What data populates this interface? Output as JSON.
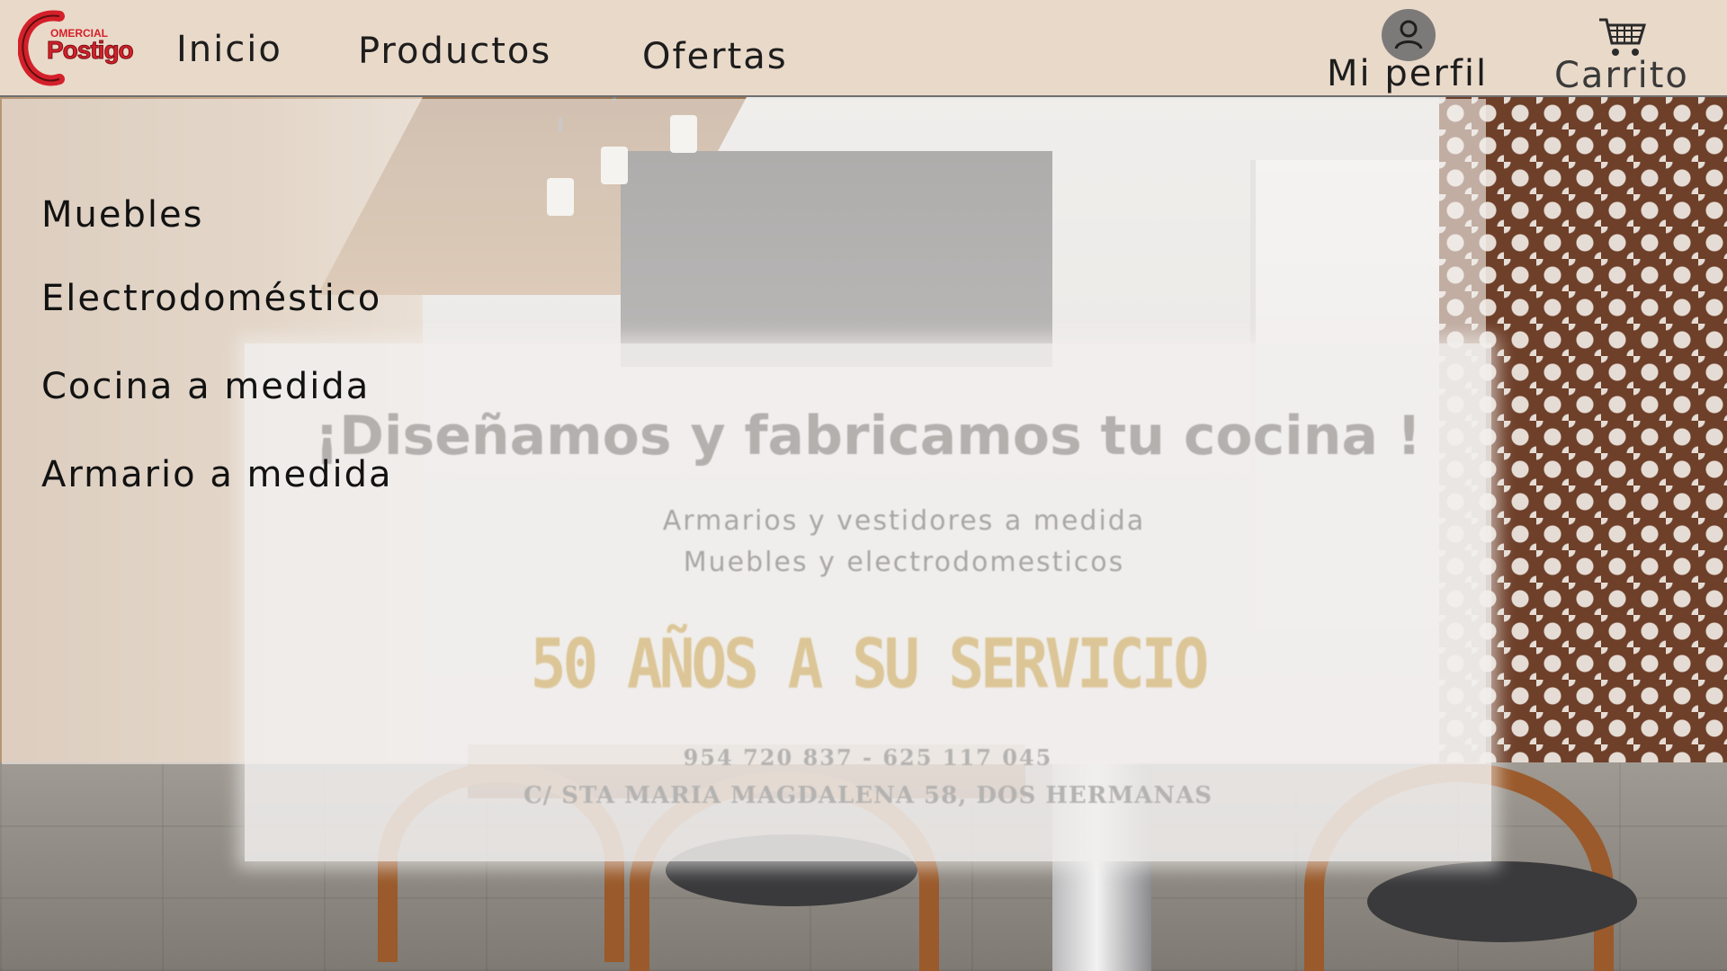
{
  "brand": {
    "logo_small": "OMERCIAL",
    "logo_main": "Postigo",
    "accent_color": "#d4202a"
  },
  "header": {
    "background": "#e9d9c9",
    "nav": {
      "inicio": "Inicio",
      "productos": "Productos",
      "ofertas": "Ofertas"
    },
    "profile_label": "Mi perfil",
    "cart_label": "Carrito"
  },
  "dropdown": {
    "items": [
      {
        "label": "Muebles"
      },
      {
        "label": "Electrodoméstico"
      },
      {
        "label": "Cocina a medida"
      },
      {
        "label": "Armario a medida"
      }
    ]
  },
  "banner": {
    "title": "¡Diseñamos y fabricamos tu cocina !",
    "subtitle_1": "Armarios y vestidores a medida",
    "subtitle_2": "Muebles y electrodomesticos",
    "service": "50 AÑOS A SU SERVICIO",
    "phones": "954 720 837 - 625 117 045",
    "address": "C/ STA MARIA MAGDALENA 58, DOS HERMANAS"
  },
  "icons": {
    "profile": "user-icon",
    "cart": "cart-icon"
  }
}
